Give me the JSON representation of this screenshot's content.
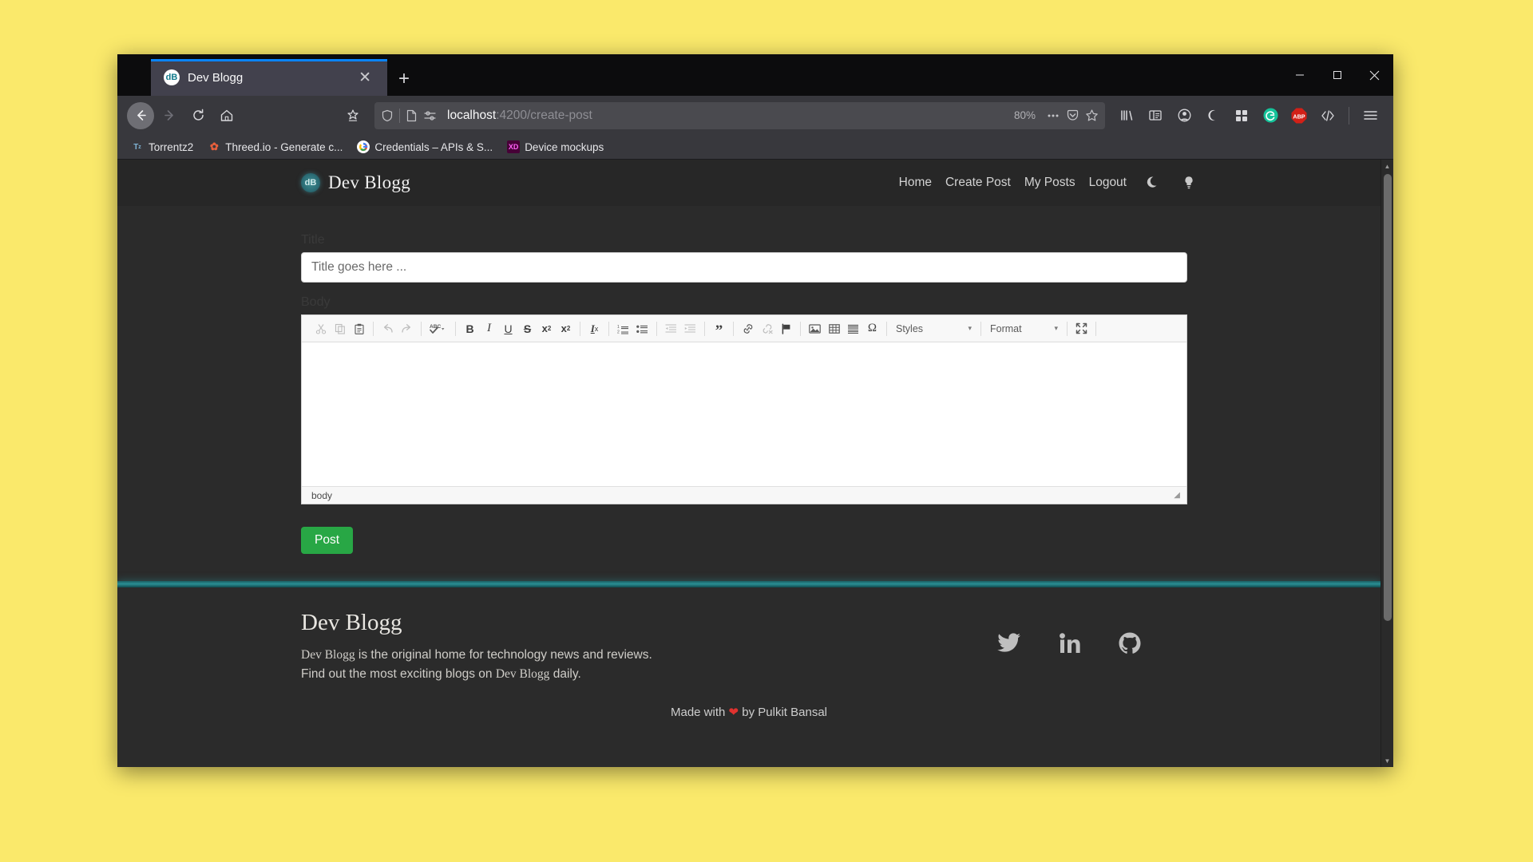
{
  "browser": {
    "tab": {
      "title": "Dev Blogg",
      "favicon_text": "dB",
      "favicon_name": "dev-blogg-favicon"
    },
    "new_tab_label": "+",
    "url": {
      "host": "localhost",
      "rest": ":4200/create-post"
    },
    "zoom_level": "80%",
    "bookmarks": [
      {
        "label": "Torrentz2",
        "icon_text": "Tz",
        "icon_bg": "#38383d",
        "icon_color": "#7fb3d5"
      },
      {
        "label": "Threed.io - Generate c...",
        "icon_text": "✿",
        "icon_bg": "#38383d",
        "icon_color": "#e8603c"
      },
      {
        "label": "Credentials – APIs & S...",
        "icon_text": "G",
        "icon_bg": "#ffffff",
        "icon_color": "#4285f4"
      },
      {
        "label": "Device mockups",
        "icon_text": "XD",
        "icon_bg": "#470137",
        "icon_color": "#ff61f6"
      }
    ],
    "toolbar_icons": [
      "back-icon",
      "forward-icon",
      "reload-icon",
      "home-icon",
      "pocket-save-icon",
      "shield-icon",
      "page-icon",
      "permissions-icon",
      "ellipsis-icon",
      "pocket-icon",
      "bookmark-star-icon",
      "library-icon",
      "sidebar-icon",
      "account-icon",
      "container-icon",
      "extensions-grid-icon",
      "grammarly-icon",
      "adblock-icon",
      "devtools-icon",
      "menu-icon"
    ],
    "window_controls": [
      "minimize",
      "maximize",
      "close"
    ],
    "adblock_label": "ABP",
    "grammarly_label": "G"
  },
  "site": {
    "brand": {
      "logo_text": "dB",
      "name": "Dev Blogg"
    },
    "nav_links": [
      "Home",
      "Create Post",
      "My Posts",
      "Logout"
    ],
    "theme_icons": [
      "moon-icon",
      "lightbulb-icon"
    ]
  },
  "form": {
    "title_label": "Title",
    "title_placeholder": "Title goes here ...",
    "title_value": "",
    "body_label": "Body",
    "submit_label": "Post"
  },
  "editor": {
    "toolbar_groups": [
      {
        "buttons": [
          {
            "name": "cut-icon",
            "glyph": "✂",
            "dim": true
          },
          {
            "name": "copy-icon",
            "glyph": "⧉",
            "dim": true
          },
          {
            "name": "paste-icon",
            "glyph": "📋",
            "dim": false
          }
        ]
      },
      {
        "buttons": [
          {
            "name": "undo-icon",
            "glyph": "↩",
            "dim": true
          },
          {
            "name": "redo-icon",
            "glyph": "↪",
            "dim": true
          }
        ]
      },
      {
        "buttons": [
          {
            "name": "spellcheck-icon",
            "glyph": "ABC",
            "dim": false,
            "has_caret": true
          }
        ]
      },
      {
        "buttons": [
          {
            "name": "bold-icon",
            "glyph": "B",
            "dim": false
          },
          {
            "name": "italic-icon",
            "glyph": "I",
            "dim": false
          },
          {
            "name": "underline-icon",
            "glyph": "U",
            "dim": false
          },
          {
            "name": "strikethrough-icon",
            "glyph": "S",
            "dim": false
          },
          {
            "name": "subscript-icon",
            "glyph": "x₂",
            "dim": false
          },
          {
            "name": "superscript-icon",
            "glyph": "x²",
            "dim": false
          }
        ]
      },
      {
        "buttons": [
          {
            "name": "remove-format-icon",
            "glyph": "Iₓ",
            "dim": false
          }
        ]
      },
      {
        "buttons": [
          {
            "name": "numbered-list-icon",
            "glyph": "≣",
            "dim": false
          },
          {
            "name": "bulleted-list-icon",
            "glyph": "☰",
            "dim": false
          }
        ]
      },
      {
        "buttons": [
          {
            "name": "outdent-icon",
            "glyph": "←≣",
            "dim": true
          },
          {
            "name": "indent-icon",
            "glyph": "→≣",
            "dim": true
          }
        ]
      },
      {
        "buttons": [
          {
            "name": "blockquote-icon",
            "glyph": "”",
            "dim": false
          }
        ]
      },
      {
        "buttons": [
          {
            "name": "link-icon",
            "glyph": "🔗",
            "dim": false
          },
          {
            "name": "unlink-icon",
            "glyph": "🔗",
            "dim": true
          },
          {
            "name": "anchor-flag-icon",
            "glyph": "⚑",
            "dim": false
          }
        ]
      },
      {
        "buttons": [
          {
            "name": "image-icon",
            "glyph": "🖼",
            "dim": false
          },
          {
            "name": "table-icon",
            "glyph": "⊞",
            "dim": false
          },
          {
            "name": "horizontal-rule-icon",
            "glyph": "≡",
            "dim": false
          },
          {
            "name": "special-char-icon",
            "glyph": "Ω",
            "dim": false
          }
        ]
      }
    ],
    "styles_dropdown": {
      "label": "Styles",
      "caret": "▾"
    },
    "format_dropdown": {
      "label": "Format",
      "caret": "▾"
    },
    "maximize_icon": "maximize-icon",
    "elements_path": "body",
    "content": ""
  },
  "footer": {
    "brand": "Dev Blogg",
    "tagline_line1_a": "Dev Blogg",
    "tagline_line1_b": " is the original home for technology news and reviews.",
    "tagline_line2_a": "Find out the most exciting blogs on ",
    "tagline_line2_b": "Dev Blogg",
    "tagline_line2_c": " daily.",
    "social": [
      "twitter-icon",
      "linkedin-icon",
      "github-icon"
    ],
    "credit_before": "Made with ",
    "credit_heart": "❤",
    "credit_after": " by Pulkit Bansal"
  },
  "colors": {
    "accent_teal": "#2a8f94",
    "post_green": "#28a745",
    "tab_accent": "#0a84ff",
    "page_bg": "#2b2b2b"
  }
}
